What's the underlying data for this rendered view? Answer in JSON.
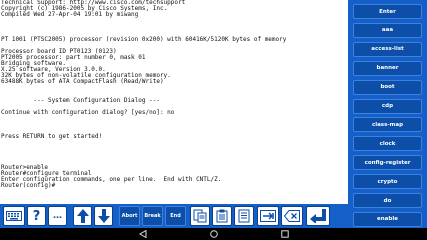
{
  "terminal": {
    "lines": [
      "Technical Support: http://www.cisco.com/techsupport",
      "Copyright (c) 1986-2005 by Cisco Systems, Inc.",
      "Compiled Wed 27-Apr-04 19:01 by miwang",
      "",
      "",
      "",
      "PT 1001 (PTSC2005) processor (revision 0x200) with 60416K/5120K bytes of memory",
      "",
      "Processor board ID PT0123 (0123)",
      "PT2005 processor: part number 0, mask 01",
      "Bridging software.",
      "X.25 software, Version 3.0.0.",
      "32K bytes of non-volatile configuration memory.",
      "63488K bytes of ATA CompactFlash (Read/Write)",
      "",
      "",
      "         --- System Configuration Dialog ---",
      "",
      "Continue with configuration dialog? [yes/no]: no",
      "",
      "",
      "",
      "Press RETURN to get started!",
      "",
      "",
      "",
      "",
      "Router>enable",
      "Router#configure terminal",
      "Enter configuration commands, one per line.  End with CNTL/Z.",
      "Router(config)#"
    ]
  },
  "sidebar": {
    "buttons": [
      "Enter",
      "aaa",
      "access-list",
      "banner",
      "boot",
      "cdp",
      "class-map",
      "clock",
      "config-register",
      "crypto",
      "do",
      "enable"
    ]
  },
  "toolbar": {
    "abort": "Abort",
    "break": "Break",
    "end": "End"
  }
}
